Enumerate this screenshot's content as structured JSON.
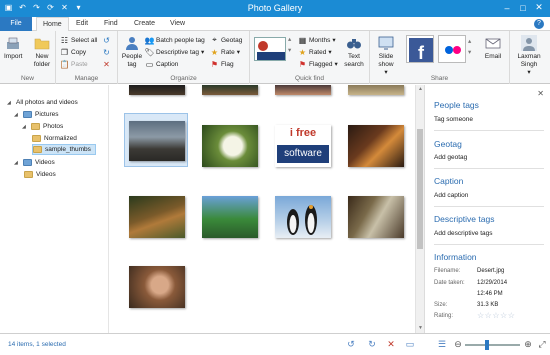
{
  "window": {
    "title": "Photo Gallery",
    "colors": {
      "titlebar": "#1b8bd4",
      "accent": "#2b79c2",
      "link": "#2b6cb0"
    }
  },
  "menu_tabs": [
    "File",
    "Home",
    "Edit",
    "Find",
    "Create",
    "View"
  ],
  "ribbon": {
    "new": {
      "label": "New",
      "import": "Import",
      "new_folder": "New folder"
    },
    "manage": {
      "label": "Manage",
      "select_all": "Select all",
      "copy": "Copy",
      "paste": "Paste"
    },
    "organize": {
      "label": "Organize",
      "people_tag": "People tag",
      "batch_people_tag": "Batch people tag",
      "descriptive_tag": "Descriptive tag",
      "caption": "Caption",
      "geotag": "Geotag",
      "rate": "Rate",
      "flag": "Flag"
    },
    "quick_find": {
      "label": "Quick find",
      "months": "Months",
      "rated": "Rated",
      "flagged": "Flagged",
      "text_search": "Text search"
    },
    "share": {
      "label": "Share",
      "slide_show": "Slide show",
      "email": "Email",
      "user": "Laxman Singh"
    }
  },
  "nav": {
    "root": "All photos and videos",
    "pictures": "Pictures",
    "photos": "Photos",
    "normalized": "Normalized",
    "sample_thumbs": "sample_thumbs",
    "videos_group": "Videos",
    "videos": "Videos"
  },
  "thumb_logo": {
    "line1": "i free",
    "line2": "software"
  },
  "info_pane": {
    "people_tags": {
      "heading": "People tags",
      "action": "Tag someone"
    },
    "geotag": {
      "heading": "Geotag",
      "action": "Add geotag"
    },
    "caption": {
      "heading": "Caption",
      "action": "Add caption"
    },
    "descriptive_tags": {
      "heading": "Descriptive tags",
      "action": "Add descriptive tags"
    },
    "information": {
      "heading": "Information",
      "filename_label": "Filename:",
      "filename": "Desert.jpg",
      "date_label": "Date taken:",
      "date": "12/29/2014",
      "time": "12:46 PM",
      "size_label": "Size:",
      "size": "31.3 KB",
      "rating_label": "Rating:",
      "rating_value": 0,
      "rating_max": 5
    }
  },
  "status": {
    "text": "14 items, 1 selected"
  }
}
